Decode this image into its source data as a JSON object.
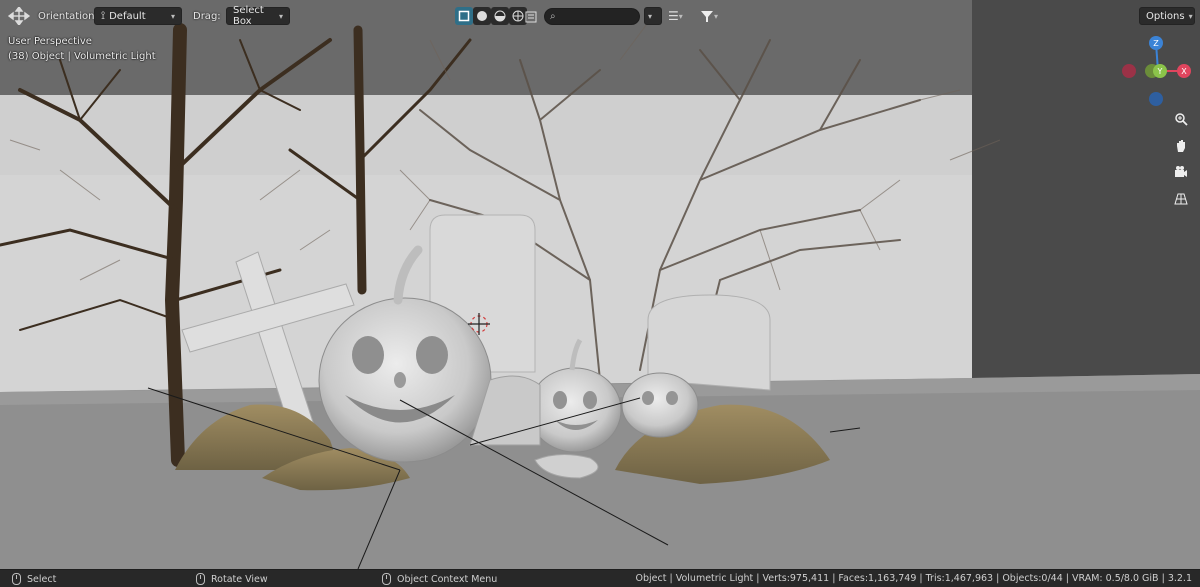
{
  "header": {
    "orientation_label": "Orientation:",
    "orientation_value": "Default",
    "drag_label": "Drag:",
    "drag_value": "Select Box",
    "search_placeholder": "",
    "options_label": "Options"
  },
  "overlay": {
    "perspective": "User Perspective",
    "object_info": "(38) Object | Volumetric Light"
  },
  "gizmo": {
    "z_label": "Z",
    "y_label": "Y",
    "x_label": "X",
    "colors": {
      "x": "#e0455e",
      "y": "#8bc34a",
      "z": "#3b83d6"
    }
  },
  "nav_buttons": [
    "zoom-icon",
    "hand-pan-icon",
    "camera-icon",
    "grid-ortho-icon"
  ],
  "statusbar": {
    "select": "Select",
    "rotate_view": "Rotate View",
    "context_menu": "Object Context Menu",
    "stats": "Object | Volumetric Light | Verts:975,411 | Faces:1,163,749 | Tris:1,467,963 | Objects:0/44 | VRAM: 0.5/8.0 GiB | 3.2.1"
  },
  "colors": {
    "accent_active": "#2f6f88",
    "header_bg": "#2b2b2b",
    "statusbar_bg": "#282828"
  }
}
